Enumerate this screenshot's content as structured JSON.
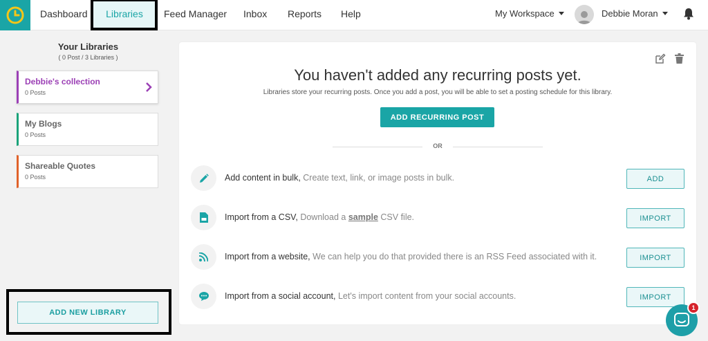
{
  "nav": {
    "items": [
      {
        "label": "Dashboard"
      },
      {
        "label": "Libraries"
      },
      {
        "label": "Feed Manager"
      },
      {
        "label": "Inbox"
      },
      {
        "label": "Reports"
      },
      {
        "label": "Help"
      }
    ],
    "workspace": "My Workspace",
    "user_name": "Debbie Moran"
  },
  "sidebar": {
    "title": "Your Libraries",
    "subtitle": "( 0 Post / 3 Libraries )",
    "libraries": [
      {
        "name": "Debbie's collection",
        "count": "0 Posts",
        "color": "#9b3fb5"
      },
      {
        "name": "My Blogs",
        "count": "0 Posts",
        "color": "#1aa37a"
      },
      {
        "name": "Shareable Quotes",
        "count": "0 Posts",
        "color": "#e0622a"
      }
    ],
    "add_library_label": "ADD NEW LIBRARY"
  },
  "main": {
    "headline": "You haven't added any recurring posts yet.",
    "subline": "Libraries store your recurring posts. Once you add a post, you will be able to set a posting schedule for this library.",
    "add_post_label": "ADD RECURRING POST",
    "or_label": "OR",
    "options": [
      {
        "title": "Add content in bulk,",
        "desc": "Create text, link, or image posts in bulk.",
        "button": "ADD",
        "icon": "pencil-icon"
      },
      {
        "title": "Import from a CSV,",
        "desc_before": "Download a",
        "sample": "sample",
        "desc_after": "CSV file.",
        "button": "IMPORT",
        "icon": "csv-file-icon"
      },
      {
        "title": "Import from a website,",
        "desc": "We can help you do that provided there is an RSS Feed associated with it.",
        "button": "IMPORT",
        "icon": "rss-icon"
      },
      {
        "title": "Import from a social account,",
        "desc": "Let's import content from your social accounts.",
        "button": "IMPORT",
        "icon": "chat-bubble-icon"
      }
    ]
  },
  "chat": {
    "badge": "1"
  },
  "colors": {
    "accent": "#1aa5a6",
    "active_library": "#9b3fb5",
    "badge": "#d6242c"
  }
}
